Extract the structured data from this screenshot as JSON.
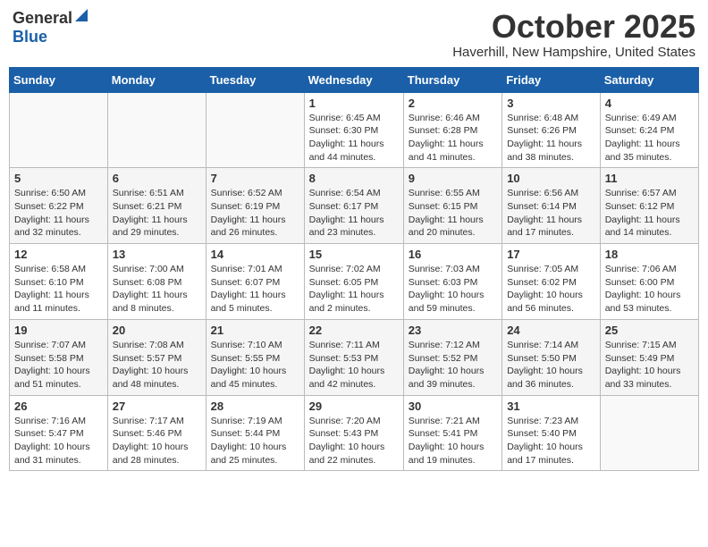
{
  "logo": {
    "general": "General",
    "blue": "Blue"
  },
  "header": {
    "month": "October 2025",
    "location": "Haverhill, New Hampshire, United States"
  },
  "weekdays": [
    "Sunday",
    "Monday",
    "Tuesday",
    "Wednesday",
    "Thursday",
    "Friday",
    "Saturday"
  ],
  "weeks": [
    [
      {
        "day": "",
        "info": ""
      },
      {
        "day": "",
        "info": ""
      },
      {
        "day": "",
        "info": ""
      },
      {
        "day": "1",
        "info": "Sunrise: 6:45 AM\nSunset: 6:30 PM\nDaylight: 11 hours\nand 44 minutes."
      },
      {
        "day": "2",
        "info": "Sunrise: 6:46 AM\nSunset: 6:28 PM\nDaylight: 11 hours\nand 41 minutes."
      },
      {
        "day": "3",
        "info": "Sunrise: 6:48 AM\nSunset: 6:26 PM\nDaylight: 11 hours\nand 38 minutes."
      },
      {
        "day": "4",
        "info": "Sunrise: 6:49 AM\nSunset: 6:24 PM\nDaylight: 11 hours\nand 35 minutes."
      }
    ],
    [
      {
        "day": "5",
        "info": "Sunrise: 6:50 AM\nSunset: 6:22 PM\nDaylight: 11 hours\nand 32 minutes."
      },
      {
        "day": "6",
        "info": "Sunrise: 6:51 AM\nSunset: 6:21 PM\nDaylight: 11 hours\nand 29 minutes."
      },
      {
        "day": "7",
        "info": "Sunrise: 6:52 AM\nSunset: 6:19 PM\nDaylight: 11 hours\nand 26 minutes."
      },
      {
        "day": "8",
        "info": "Sunrise: 6:54 AM\nSunset: 6:17 PM\nDaylight: 11 hours\nand 23 minutes."
      },
      {
        "day": "9",
        "info": "Sunrise: 6:55 AM\nSunset: 6:15 PM\nDaylight: 11 hours\nand 20 minutes."
      },
      {
        "day": "10",
        "info": "Sunrise: 6:56 AM\nSunset: 6:14 PM\nDaylight: 11 hours\nand 17 minutes."
      },
      {
        "day": "11",
        "info": "Sunrise: 6:57 AM\nSunset: 6:12 PM\nDaylight: 11 hours\nand 14 minutes."
      }
    ],
    [
      {
        "day": "12",
        "info": "Sunrise: 6:58 AM\nSunset: 6:10 PM\nDaylight: 11 hours\nand 11 minutes."
      },
      {
        "day": "13",
        "info": "Sunrise: 7:00 AM\nSunset: 6:08 PM\nDaylight: 11 hours\nand 8 minutes."
      },
      {
        "day": "14",
        "info": "Sunrise: 7:01 AM\nSunset: 6:07 PM\nDaylight: 11 hours\nand 5 minutes."
      },
      {
        "day": "15",
        "info": "Sunrise: 7:02 AM\nSunset: 6:05 PM\nDaylight: 11 hours\nand 2 minutes."
      },
      {
        "day": "16",
        "info": "Sunrise: 7:03 AM\nSunset: 6:03 PM\nDaylight: 10 hours\nand 59 minutes."
      },
      {
        "day": "17",
        "info": "Sunrise: 7:05 AM\nSunset: 6:02 PM\nDaylight: 10 hours\nand 56 minutes."
      },
      {
        "day": "18",
        "info": "Sunrise: 7:06 AM\nSunset: 6:00 PM\nDaylight: 10 hours\nand 53 minutes."
      }
    ],
    [
      {
        "day": "19",
        "info": "Sunrise: 7:07 AM\nSunset: 5:58 PM\nDaylight: 10 hours\nand 51 minutes."
      },
      {
        "day": "20",
        "info": "Sunrise: 7:08 AM\nSunset: 5:57 PM\nDaylight: 10 hours\nand 48 minutes."
      },
      {
        "day": "21",
        "info": "Sunrise: 7:10 AM\nSunset: 5:55 PM\nDaylight: 10 hours\nand 45 minutes."
      },
      {
        "day": "22",
        "info": "Sunrise: 7:11 AM\nSunset: 5:53 PM\nDaylight: 10 hours\nand 42 minutes."
      },
      {
        "day": "23",
        "info": "Sunrise: 7:12 AM\nSunset: 5:52 PM\nDaylight: 10 hours\nand 39 minutes."
      },
      {
        "day": "24",
        "info": "Sunrise: 7:14 AM\nSunset: 5:50 PM\nDaylight: 10 hours\nand 36 minutes."
      },
      {
        "day": "25",
        "info": "Sunrise: 7:15 AM\nSunset: 5:49 PM\nDaylight: 10 hours\nand 33 minutes."
      }
    ],
    [
      {
        "day": "26",
        "info": "Sunrise: 7:16 AM\nSunset: 5:47 PM\nDaylight: 10 hours\nand 31 minutes."
      },
      {
        "day": "27",
        "info": "Sunrise: 7:17 AM\nSunset: 5:46 PM\nDaylight: 10 hours\nand 28 minutes."
      },
      {
        "day": "28",
        "info": "Sunrise: 7:19 AM\nSunset: 5:44 PM\nDaylight: 10 hours\nand 25 minutes."
      },
      {
        "day": "29",
        "info": "Sunrise: 7:20 AM\nSunset: 5:43 PM\nDaylight: 10 hours\nand 22 minutes."
      },
      {
        "day": "30",
        "info": "Sunrise: 7:21 AM\nSunset: 5:41 PM\nDaylight: 10 hours\nand 19 minutes."
      },
      {
        "day": "31",
        "info": "Sunrise: 7:23 AM\nSunset: 5:40 PM\nDaylight: 10 hours\nand 17 minutes."
      },
      {
        "day": "",
        "info": ""
      }
    ]
  ]
}
